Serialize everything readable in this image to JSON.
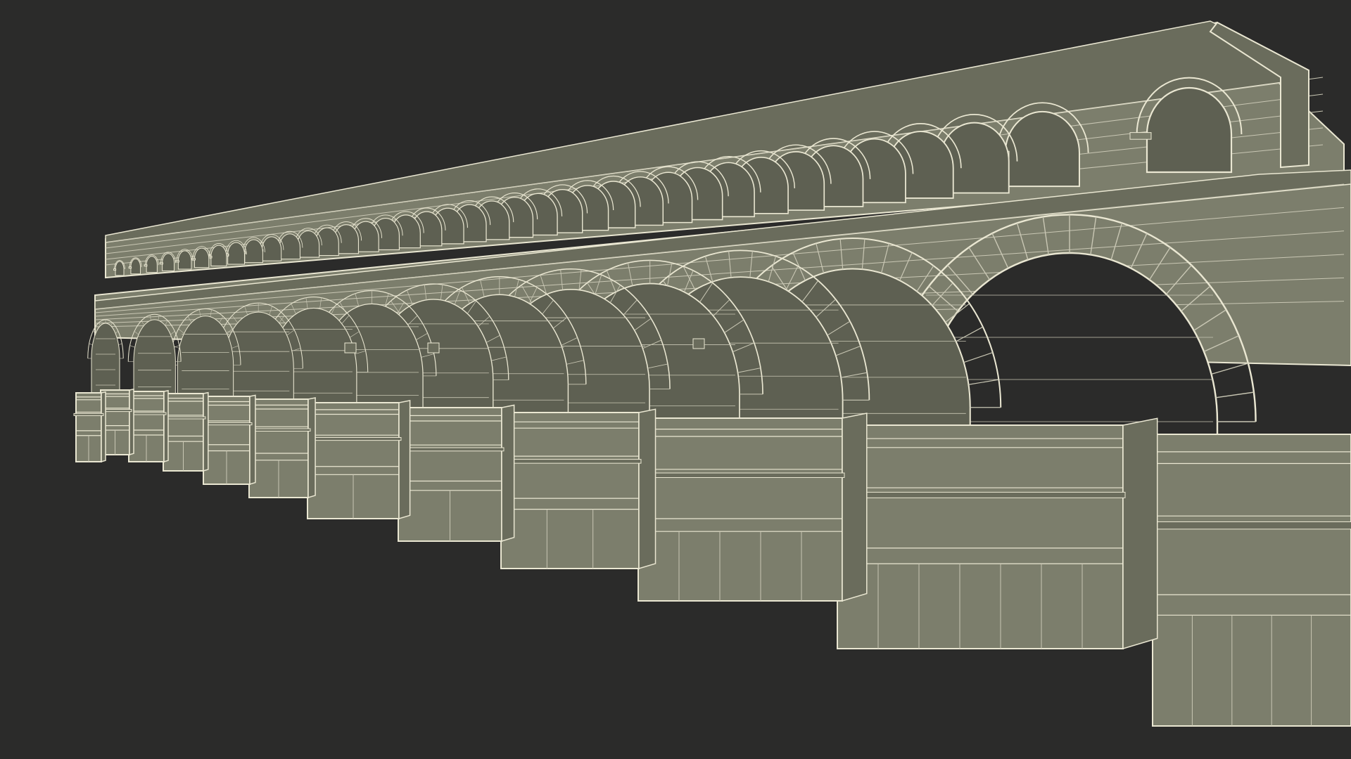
{
  "scene": {
    "subject": "aqueduct-wireframe-model",
    "render_style": "wireframe-over-shaded",
    "colors": {
      "background": "#2b2b2a",
      "surface": "#7c7e6c",
      "surface_dark": "#6a6c5c",
      "surface_shadow": "#5e6052",
      "wire": "#eae7d2",
      "wire_faint": "#c9c7b4"
    },
    "lower_tier_arch_count": 13,
    "upper_tier_arch_count": 38
  }
}
